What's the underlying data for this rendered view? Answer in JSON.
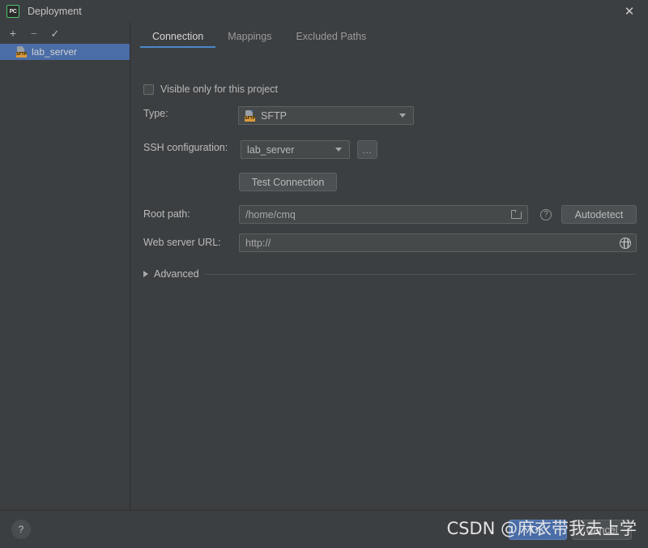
{
  "window": {
    "title": "Deployment",
    "app_icon": "pycharm-icon",
    "close_icon": "close-icon"
  },
  "sidebar": {
    "toolbar": [
      {
        "name": "add-server-button",
        "glyph": "+"
      },
      {
        "name": "remove-server-button",
        "glyph": "−"
      },
      {
        "name": "set-default-button",
        "glyph": "✓"
      }
    ],
    "items": [
      {
        "label": "lab_server",
        "icon": "sftp-icon",
        "badge": "SFTP",
        "selected": true
      }
    ]
  },
  "tabs": [
    {
      "label": "Connection",
      "active": true
    },
    {
      "label": "Mappings",
      "active": false
    },
    {
      "label": "Excluded Paths",
      "active": false
    }
  ],
  "connection": {
    "visible_only_checkbox": {
      "label": "Visible only for this project",
      "checked": false
    },
    "type": {
      "label": "Type:",
      "value": "SFTP",
      "icon": "sftp-icon",
      "badge": "SFTP"
    },
    "ssh_configuration": {
      "label": "SSH configuration:",
      "value": "lab_server",
      "browse_label": "..."
    },
    "test_connection_label": "Test Connection",
    "root_path": {
      "label": "Root path:",
      "value": "/home/cmq",
      "folder_icon": "folder-icon",
      "help_icon": "help-icon",
      "autodetect_label": "Autodetect"
    },
    "web_server_url": {
      "label": "Web server URL:",
      "value": "http://",
      "globe_icon": "globe-icon"
    },
    "advanced": {
      "label": "Advanced",
      "expanded": false,
      "chevron_icon": "chevron-right-icon"
    }
  },
  "footer": {
    "help_label": "?",
    "ok_label": "OK",
    "cancel_label": "Cancel"
  },
  "watermark": {
    "text": "CSDN @麻衣带我去上学"
  },
  "colors": {
    "background": "#3c3f41",
    "accent": "#4a6da7",
    "tab_underline": "#4a88c7",
    "field_background": "#45494a",
    "badge": "#d89b3c"
  }
}
